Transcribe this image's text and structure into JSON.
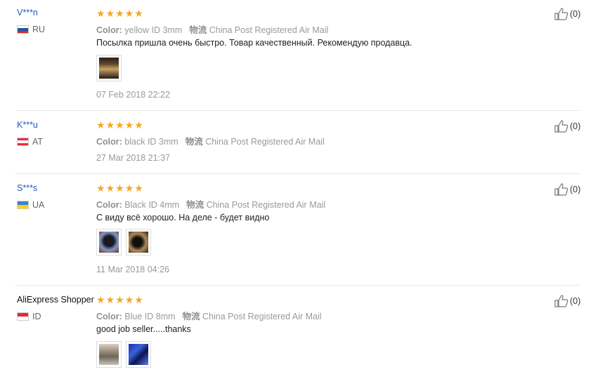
{
  "reviews": [
    {
      "user": "V***n",
      "country": "RU",
      "flag": [
        "#ffffff",
        "#1c57a5",
        "#d52b1e"
      ],
      "stars": 5,
      "color_label": "Color:",
      "color_value": "yellow ID 3mm",
      "ship_label": "物流",
      "ship_value": "China Post Registered Air Mail",
      "text": "Посылка пришла очень быстро. Товар качественный. Рекомендую продавца.",
      "photos": [
        "photo-1"
      ],
      "date": "07 Feb 2018 22:22",
      "helpful_count": "(0)"
    },
    {
      "user": "K***u",
      "country": "AT",
      "flag": [
        "#ed2939",
        "#ffffff",
        "#ed2939"
      ],
      "stars": 5,
      "color_label": "Color:",
      "color_value": "black ID 3mm",
      "ship_label": "物流",
      "ship_value": "China Post Registered Air Mail",
      "text": "",
      "photos": [],
      "date": "27 Mar 2018 21:37",
      "helpful_count": "(0)"
    },
    {
      "user": "S***s",
      "country": "UA",
      "flag": [
        "#3f7fd6",
        "#f7d700"
      ],
      "stars": 5,
      "color_label": "Color:",
      "color_value": "Black ID 4mm",
      "ship_label": "物流",
      "ship_value": "China Post Registered Air Mail",
      "text": "С виду всё хорошо. На деле - будет видно",
      "photos": [
        "photo-1",
        "photo-2"
      ],
      "date": "11 Mar 2018 04:26",
      "helpful_count": "(0)"
    },
    {
      "user": "AliExpress Shopper",
      "country": "ID",
      "flag": [
        "#e4293b",
        "#ffffff"
      ],
      "stars": 5,
      "color_label": "Color:",
      "color_value": "Blue ID 8mm",
      "ship_label": "物流",
      "ship_value": "China Post Registered Air Mail",
      "text": "good job seller.....thanks",
      "photos": [
        "photo-1",
        "photo-2"
      ],
      "date": "",
      "helpful_count": "(0)"
    }
  ]
}
